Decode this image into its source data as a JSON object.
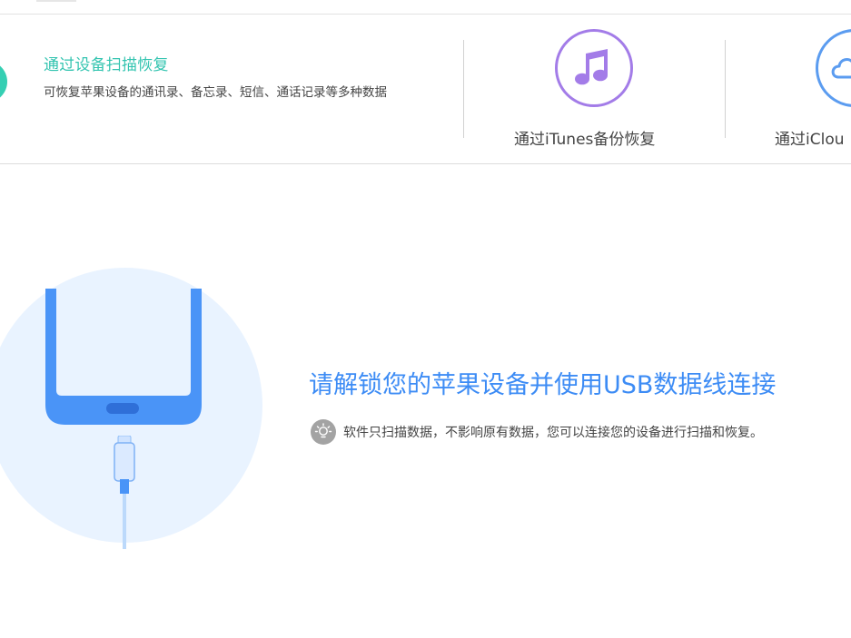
{
  "modes": {
    "scan": {
      "title": "通过设备扫描恢复",
      "description": "可恢复苹果设备的通讯录、备忘录、短信、通话记录等多种数据",
      "icon": "scan-device-icon",
      "color": "#35cfb3"
    },
    "itunes": {
      "label": "通过iTunes备份恢复",
      "icon": "music-note-icon",
      "color": "#a37ce8"
    },
    "icloud": {
      "label": "通过iClou",
      "icon": "cloud-icon",
      "color": "#5b9cf0"
    }
  },
  "main": {
    "headline": "请解锁您的苹果设备并使用USB数据线连接",
    "tip": "软件只扫描数据，不影响原有数据，您可以连接您的设备进行扫描和恢复。",
    "tip_icon": "lightbulb-icon",
    "accent": "#3d8cf5"
  }
}
